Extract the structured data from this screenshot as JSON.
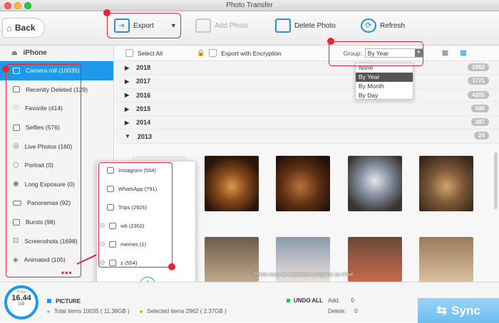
{
  "window": {
    "title": "Photo Transfer"
  },
  "toolbar": {
    "back": "Back",
    "export": "Export",
    "add_photo": "Add Photo",
    "delete_photo": "Delete Photo",
    "refresh": "Refresh"
  },
  "sidebar": {
    "device": "iPhone",
    "items": [
      {
        "label": "Camera roll (10035)",
        "icon": "camera-icon"
      },
      {
        "label": "Recently Deleted (129)",
        "icon": "trash-icon"
      },
      {
        "label": "Favorite (414)",
        "icon": "heart-icon"
      },
      {
        "label": "Selfies (576)",
        "icon": "selfie-icon"
      },
      {
        "label": "Live Photos (160)",
        "icon": "live-photo-icon"
      },
      {
        "label": "Portrait (0)",
        "icon": "cube-icon"
      },
      {
        "label": "Long Exposure (0)",
        "icon": "long-exposure-icon"
      },
      {
        "label": "Panoramas (92)",
        "icon": "panorama-icon"
      },
      {
        "label": "Bursts (98)",
        "icon": "burst-icon"
      },
      {
        "label": "Screenshots (1698)",
        "icon": "screenshot-icon"
      },
      {
        "label": "Animated (105)",
        "icon": "animated-icon"
      }
    ]
  },
  "header": {
    "select_all": "Select All",
    "export_encryption": "Export with Encryption",
    "group_label": "Group:",
    "group_value": "By Year"
  },
  "group_options": [
    "None",
    "By Year",
    "By Month",
    "By Day"
  ],
  "years": [
    {
      "year": "2018",
      "count": "2962"
    },
    {
      "year": "2017",
      "count": "1771"
    },
    {
      "year": "2016",
      "count": "4205"
    },
    {
      "year": "2015",
      "count": "686"
    },
    {
      "year": "2014",
      "count": "387"
    },
    {
      "year": "2013",
      "count": "24"
    }
  ],
  "albums": [
    "Instagram (554)",
    "WhatsApp (791)",
    "Trips (2926)",
    "wb (2302)",
    "memes (1)",
    "z (554)"
  ],
  "notice": "Photo may be exported & imports on iPad",
  "footer": {
    "free_label": "Free",
    "free_value": "16.44",
    "free_unit": "GB",
    "picture_label": "PICTURE",
    "total": "Total items 10035 ( 11.38GB )",
    "selected": "Selected items 2962 ( 2.37GB )",
    "undo_all": "UNDO ALL",
    "add_label": "Add:",
    "add_value": "0",
    "delete_label": "Delete:",
    "delete_value": "0",
    "sync": "Sync"
  },
  "colors": {
    "accent": "#1e98ea",
    "annotation": "#e3263a"
  }
}
